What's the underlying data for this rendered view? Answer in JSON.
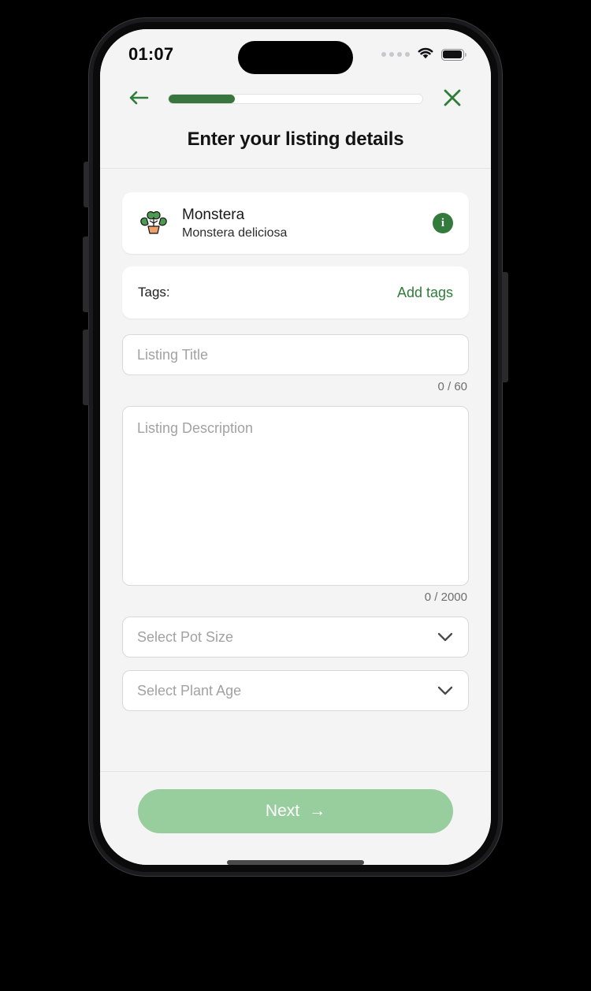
{
  "device": {
    "status_bar": {
      "time": "01:07",
      "cellular_icon": "signal-dots-icon",
      "wifi_icon": "wifi-icon",
      "battery_icon": "battery-icon"
    },
    "home_indicator": "home-indicator"
  },
  "nav": {
    "back_icon": "arrow-left-icon",
    "close_icon": "close-icon",
    "progress_percent": 26,
    "progress_color": "#39763f"
  },
  "header": {
    "title": "Enter your listing details"
  },
  "plant_card": {
    "icon": "potted-plant-icon",
    "emoji": "🪴",
    "name": "Monstera",
    "species": "Monstera deliciosa",
    "info_icon": "info-icon",
    "info_glyph": "i",
    "info_color": "#337a3d"
  },
  "tags_card": {
    "label": "Tags:",
    "action_label": "Add tags",
    "action_color": "#2f7d3a"
  },
  "listing_title": {
    "placeholder": "Listing Title",
    "value": "",
    "counter": "0 / 60"
  },
  "listing_description": {
    "placeholder": "Listing Description",
    "value": "",
    "counter": "0 / 2000"
  },
  "pot_size": {
    "placeholder": "Select Pot Size",
    "value": "",
    "chevron_icon": "chevron-down-icon"
  },
  "plant_age": {
    "placeholder": "Select Plant Age",
    "value": "",
    "chevron_icon": "chevron-down-icon"
  },
  "footer": {
    "next_label": "Next",
    "next_arrow": "→",
    "next_color": "#98ce9e"
  }
}
